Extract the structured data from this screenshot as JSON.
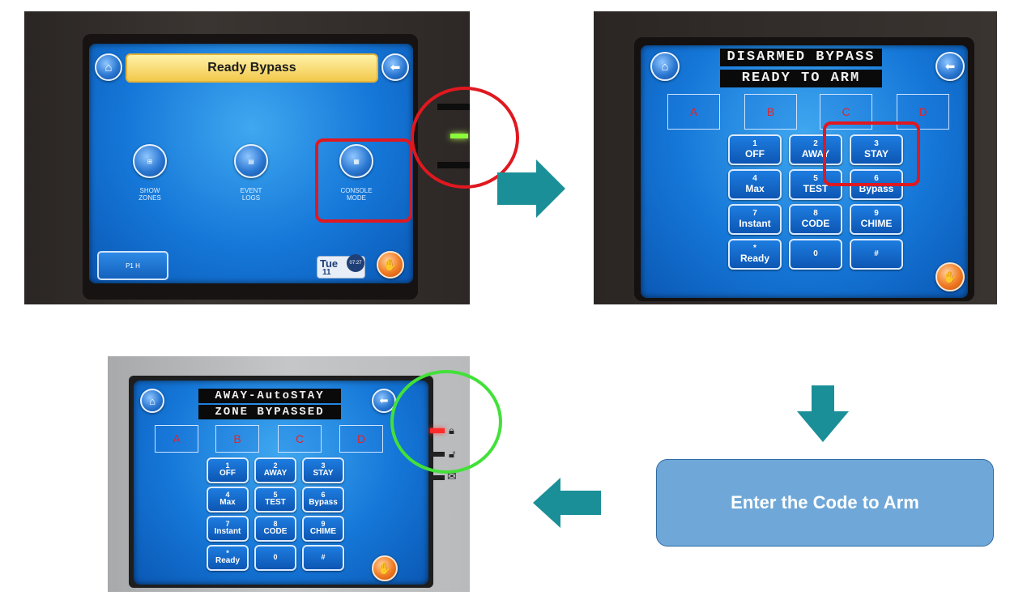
{
  "panel1": {
    "title": "Ready Bypass",
    "icons": [
      {
        "label": "SHOW\nZONES",
        "name": "show-zones"
      },
      {
        "label": "EVENT\nLOGS",
        "name": "event-logs"
      },
      {
        "label": "CONSOLE\nMODE",
        "name": "console-mode"
      }
    ],
    "partition_label": "P1  H",
    "day": "Tue",
    "date": "11",
    "time": "07:27"
  },
  "panel2": {
    "line1": "DISARMED BYPASS",
    "line2": "READY TO ARM"
  },
  "panel3": {
    "line1": "AWAY-AutoSTAY",
    "line2": "ZONE BYPASSED"
  },
  "zones": [
    "A",
    "B",
    "C",
    "D"
  ],
  "keys": [
    {
      "num": "1",
      "label": "OFF"
    },
    {
      "num": "2",
      "label": "AWAY"
    },
    {
      "num": "3",
      "label": "STAY"
    },
    {
      "num": "4",
      "label": "Max"
    },
    {
      "num": "5",
      "label": "TEST"
    },
    {
      "num": "6",
      "label": "Bypass"
    },
    {
      "num": "7",
      "label": "Instant"
    },
    {
      "num": "8",
      "label": "CODE"
    },
    {
      "num": "9",
      "label": "CHIME"
    },
    {
      "num": "*",
      "label": "Ready"
    },
    {
      "num": "0",
      "label": ""
    },
    {
      "num": "#",
      "label": ""
    }
  ],
  "step_box": "Enter the Code to Arm",
  "colors": {
    "arrow": "#1b8f98",
    "step_box": "#6fa8d8",
    "red_highlight": "#e0181f",
    "green_highlight": "#43e03a"
  }
}
